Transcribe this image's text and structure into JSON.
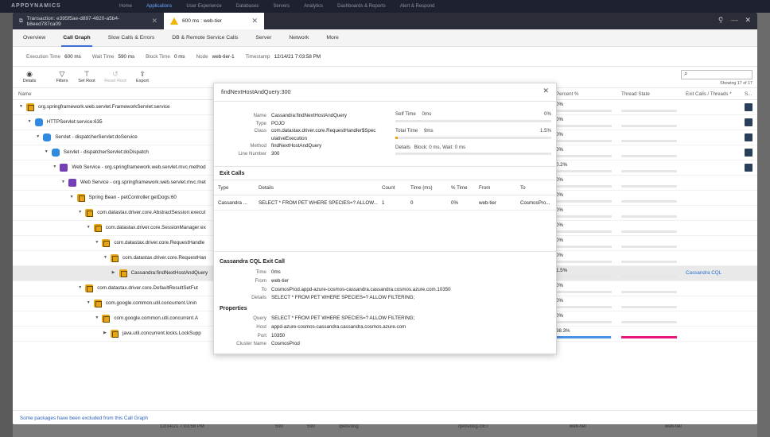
{
  "background": {
    "logo": "APPDYNAMICS",
    "nav": [
      "Home",
      "Applications",
      "User Experience",
      "Databases",
      "Servers",
      "Analytics",
      "Dashboards & Reports",
      "Alert & Respond"
    ],
    "active_nav": "Applications",
    "bottom_row": [
      "12/14/21 7:03:58 PM",
      "590",
      "590",
      "/pets/dog",
      "/pets/dog.GET",
      "web-tier",
      "web-tier"
    ]
  },
  "window": {
    "tab1": "Transaction: e395f5ae-d897-4820-a5b4-b8eed787ca09",
    "tab2": "600 ms : web-tier"
  },
  "tabs": [
    "Overview",
    "Call Graph",
    "Slow Calls & Errors",
    "DB & Remote Service Calls",
    "Server",
    "Network",
    "More"
  ],
  "active_tab": "Call Graph",
  "actions_label": "Actions",
  "summary": [
    {
      "label": "Execution Time",
      "value": "600 ms"
    },
    {
      "label": "Wait Time",
      "value": "590 ms"
    },
    {
      "label": "Block Time",
      "value": "0 ms"
    },
    {
      "label": "Node",
      "value": "web-tier-1"
    },
    {
      "label": "Timestamp",
      "value": "12/14/21 7:03:58 PM"
    }
  ],
  "toolbar": {
    "details": "Details",
    "filters": "Filters",
    "set_root": "Set Root",
    "reset_root": "Reset Root",
    "export": "Export",
    "showing": "Showing 17 of 17"
  },
  "columns": {
    "name": "Name",
    "percent": "Percent %",
    "thread_state": "Thread State",
    "exit_calls": "Exit Calls / Threads *",
    "s": "S..."
  },
  "rows": [
    {
      "name": "org.springframework.web.servlet.FrameworkServlet:service",
      "level": 0,
      "icon": "yellow",
      "pct": "0%",
      "fill": 0,
      "thread": 0,
      "exit": "",
      "expanded": true,
      "sq": true
    },
    {
      "name": "HTTPServlet:service:635",
      "level": 1,
      "icon": "blue",
      "pct": "0%",
      "fill": 0,
      "thread": 0,
      "exit": "",
      "expanded": true,
      "sq": true
    },
    {
      "name": "Servlet - dispatcherServlet:doService",
      "level": 2,
      "icon": "blue",
      "pct": "0%",
      "fill": 0,
      "thread": 0,
      "exit": "",
      "expanded": true,
      "sq": true
    },
    {
      "name": "Servlet - dispatcherServlet:doDispatch",
      "level": 3,
      "icon": "blue",
      "pct": "0%",
      "fill": 0,
      "thread": 0,
      "exit": "",
      "expanded": true,
      "sq": true
    },
    {
      "name": "Web Service - org.springframework.web.servlet.mvc.method",
      "level": 4,
      "icon": "purple",
      "pct": "0.2%",
      "fill": 0,
      "thread": 0,
      "exit": "",
      "expanded": true,
      "sq": true
    },
    {
      "name": "Web Service - org.springframework.web.servlet.mvc.met",
      "level": 5,
      "icon": "purple",
      "pct": "0%",
      "fill": 0,
      "thread": 0,
      "exit": "",
      "expanded": true,
      "sq": false
    },
    {
      "name": "Spring Bean - petController:getDogs:60",
      "level": 6,
      "icon": "yellow",
      "pct": "0%",
      "fill": 0,
      "thread": 0,
      "exit": "",
      "expanded": true,
      "sq": false
    },
    {
      "name": "com.datastax.driver.core.AbstractSession:execut",
      "level": 7,
      "icon": "yellow",
      "pct": "0%",
      "fill": 0,
      "thread": 0,
      "exit": "",
      "expanded": true,
      "sq": false
    },
    {
      "name": "com.datastax.driver.core.SessionManager:ex",
      "level": 8,
      "icon": "yellow",
      "pct": "0%",
      "fill": 0,
      "thread": 0,
      "exit": "",
      "expanded": true,
      "sq": false
    },
    {
      "name": "com.datastax.driver.core.RequestHandle",
      "level": 9,
      "icon": "yellow",
      "pct": "0%",
      "fill": 0,
      "thread": 0,
      "exit": "",
      "expanded": true,
      "sq": false
    },
    {
      "name": "com.datastax.driver.core.RequestHan",
      "level": 10,
      "icon": "yellow",
      "pct": "0%",
      "fill": 0,
      "thread": 0,
      "exit": "",
      "expanded": true,
      "sq": false
    },
    {
      "name": "Cassandra:findNextHostAndQuery",
      "level": 11,
      "icon": "yellow",
      "pct": "1.5%",
      "fill": 0,
      "thread": 0,
      "exit": "Cassandra CQL",
      "expanded": false,
      "sel": true,
      "sq": false
    },
    {
      "name": "com.datastax.driver.core.DefaultResultSetFut",
      "level": 7,
      "icon": "yellow",
      "pct": "0%",
      "fill": 0,
      "thread": 0,
      "exit": "",
      "expanded": true,
      "sq": false
    },
    {
      "name": "com.google.common.util.concurrent.Unin",
      "level": 8,
      "icon": "yellow",
      "pct": "0%",
      "fill": 0,
      "thread": 0,
      "exit": "",
      "expanded": true,
      "sq": false
    },
    {
      "name": "com.google.common.util.concurrent.A",
      "level": 9,
      "icon": "yellow",
      "pct": "0%",
      "fill": 0,
      "thread": 0,
      "exit": "",
      "expanded": true,
      "sq": false
    },
    {
      "name": "java.util.concurrent.locks.LockSupp",
      "level": 10,
      "icon": "yellow",
      "pct": "98.3%",
      "fill": 0.983,
      "thread": 1,
      "exit": "",
      "expanded": false,
      "sq": false
    }
  ],
  "footnote": "Some packages have been excluded from this Call Graph",
  "popup": {
    "title": "findNextHostAndQuery:300",
    "fields": [
      {
        "k": "Name",
        "v": "Cassandra:findNextHostAndQuery"
      },
      {
        "k": "Type",
        "v": "POJO"
      },
      {
        "k": "Class",
        "v": "com.datastax.driver.core.RequestHandler$Spec"
      },
      {
        "k": "",
        "v": "ulativeExecution"
      },
      {
        "k": "Method",
        "v": "findNextHostAndQuery"
      },
      {
        "k": "Line Number",
        "v": "300"
      }
    ],
    "self_time_label": "Self Time",
    "self_time": "0ms",
    "self_pct": "0%",
    "self_fill": 0,
    "total_time_label": "Total Time",
    "total_time": "9ms",
    "total_pct": "1.5%",
    "total_fill": 0.015,
    "details_label": "Details",
    "details_value": "Block: 0 ms, Wait: 0 ms",
    "exit_calls_title": "Exit Calls",
    "exit_cols": [
      "Type",
      "Details",
      "Count",
      "Time (ms)",
      "% Time",
      "From",
      "To"
    ],
    "exit_row": [
      "Cassandra ...",
      "SELECT * FROM PET WHERE SPECIES=? ALLOW...",
      "1",
      "0",
      "0%",
      "web-tier",
      "CosmosPro..."
    ],
    "cql_title": "Cassandra CQL Exit Call",
    "cql_fields": [
      {
        "k": "Time",
        "v": "0ms"
      },
      {
        "k": "From",
        "v": "web-tier"
      },
      {
        "k": "To",
        "v": "CosmosProd.appd-azure-cosmos-cassandra.cassandra.cosmos.azure.com.10350"
      },
      {
        "k": "Details",
        "v": "SELECT * FROM PET WHERE SPECIES=? ALLOW FILTERING;"
      }
    ],
    "props_title": "Properties",
    "props": [
      {
        "k": "Query",
        "v": "SELECT * FROM PET WHERE SPECIES=? ALLOW FILTERING;"
      },
      {
        "k": "Host",
        "v": "appd-azure-cosmos-cassandra.cassandra.cosmos.azure.com"
      },
      {
        "k": "Port",
        "v": "10350"
      },
      {
        "k": "Cluster Name",
        "v": "CosmosProd"
      }
    ]
  }
}
